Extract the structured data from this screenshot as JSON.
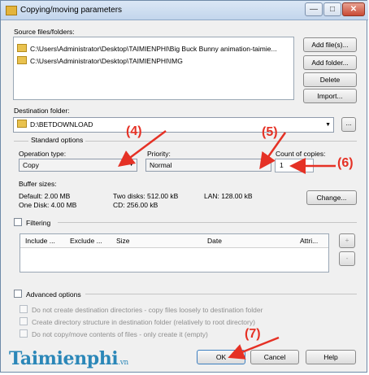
{
  "window": {
    "title": "Copying/moving parameters",
    "minimize": "—",
    "maximize": "□",
    "close": "✕"
  },
  "source": {
    "label": "Source files/folders:",
    "items": [
      "C:\\Users\\Administrator\\Desktop\\TAIMIENPHI\\Big Buck Bunny animation-taimie...",
      "C:\\Users\\Administrator\\Desktop\\TAIMIENPHI\\IMG"
    ]
  },
  "source_buttons": {
    "add_files": "Add file(s)...",
    "add_folder": "Add folder...",
    "delete": "Delete",
    "import": "Import..."
  },
  "destination": {
    "label": "Destination folder:",
    "value": "D:\\BETDOWNLOAD",
    "browse": "..."
  },
  "standard": {
    "title": "Standard options",
    "operation_label": "Operation type:",
    "operation_value": "Copy",
    "priority_label": "Priority:",
    "priority_value": "Normal",
    "count_label": "Count of copies:",
    "count_value": "1"
  },
  "buffer": {
    "label": "Buffer sizes:",
    "default": "Default: 2.00 MB",
    "one_disk": "One Disk: 4.00 MB",
    "two_disks": "Two disks: 512.00 kB",
    "cd": "CD: 256.00 kB",
    "lan": "LAN: 128.00 kB",
    "change": "Change..."
  },
  "filtering": {
    "label": "Filtering",
    "columns": [
      "Include ...",
      "Exclude ...",
      "Size",
      "Date",
      "Attri..."
    ],
    "plus": "+",
    "minus": "-"
  },
  "advanced": {
    "label": "Advanced options",
    "options": [
      "Do not create destination directories - copy files loosely to destination folder",
      "Create directory structure in destination folder (relatively to root directory)",
      "Do not copy/move contents of files - only create it (empty)"
    ]
  },
  "footer": {
    "ok": "OK",
    "cancel": "Cancel",
    "help": "Help"
  },
  "watermark": "Taimienphi",
  "watermark_sub": ".vn",
  "annotations": [
    "(4)",
    "(5)",
    "(6)",
    "(7)"
  ],
  "colors": {
    "annotation": "#e53125",
    "watermark": "#2b87b8"
  }
}
